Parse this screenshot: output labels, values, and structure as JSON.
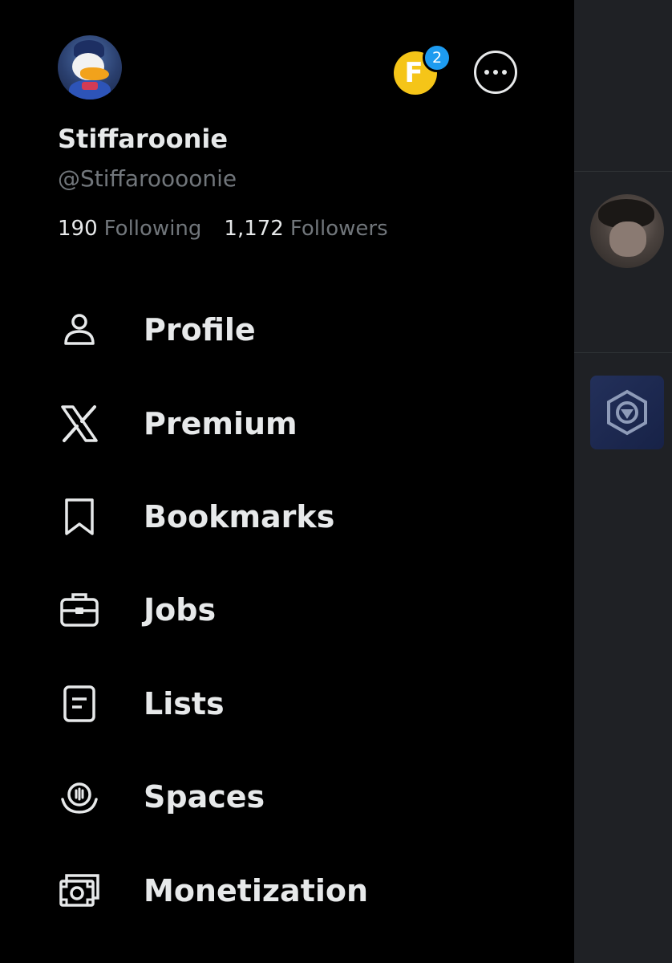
{
  "profile": {
    "display_name": "Stiffaroonie",
    "handle": "@Stiffaroooonie",
    "following_count": "190",
    "following_label": "Following",
    "followers_count": "1,172",
    "followers_label": "Followers"
  },
  "header": {
    "coin_letter": "F",
    "notification_count": "2"
  },
  "menu": {
    "items": [
      {
        "label": "Profile",
        "icon": "person-icon"
      },
      {
        "label": "Premium",
        "icon": "x-logo-icon"
      },
      {
        "label": "Bookmarks",
        "icon": "bookmark-icon"
      },
      {
        "label": "Jobs",
        "icon": "briefcase-icon"
      },
      {
        "label": "Lists",
        "icon": "list-icon"
      },
      {
        "label": "Spaces",
        "icon": "microphone-icon"
      },
      {
        "label": "Monetization",
        "icon": "money-icon"
      }
    ]
  },
  "colors": {
    "background": "#000000",
    "text_primary": "#e7e9ea",
    "text_secondary": "#71767b",
    "accent_blue": "#1d9bf0",
    "coin_yellow": "#f5c518",
    "feed_background": "#1f2125"
  }
}
